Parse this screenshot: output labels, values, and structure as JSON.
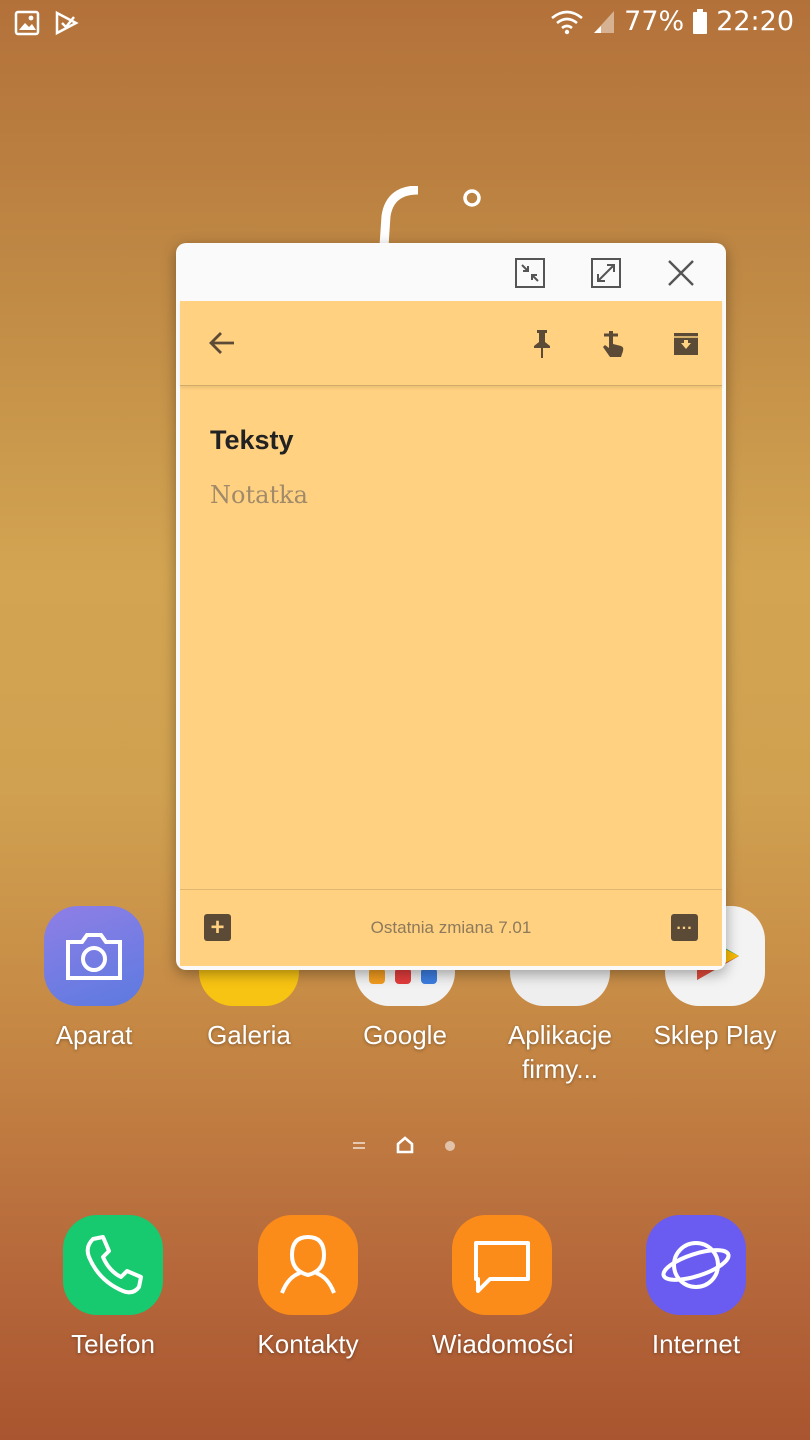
{
  "status_bar": {
    "battery": "77%",
    "time": "22:20",
    "left_icons": [
      "gallery-notification-icon",
      "play-notification-icon"
    ],
    "right_icons": [
      "wifi-icon",
      "signal-icon",
      "battery-icon"
    ]
  },
  "note_window": {
    "title": "Teksty",
    "body_placeholder": "Notatka",
    "last_modified": "Ostatnia zmiana 7.01",
    "color": "#ffd180",
    "toolbar_icons": [
      "back-arrow-icon",
      "pin-icon",
      "reminder-icon",
      "archive-icon"
    ],
    "window_icons": [
      "minimize-window-icon",
      "maximize-window-icon",
      "close-icon"
    ]
  },
  "apps_row": [
    {
      "label": "Aparat"
    },
    {
      "label": "Galeria"
    },
    {
      "label": "Google"
    },
    {
      "label": "Aplikacje firmy..."
    },
    {
      "label": "Sklep Play"
    }
  ],
  "dock": [
    {
      "label": "Telefon"
    },
    {
      "label": "Kontakty"
    },
    {
      "label": "Wiadomości"
    },
    {
      "label": "Internet"
    }
  ]
}
